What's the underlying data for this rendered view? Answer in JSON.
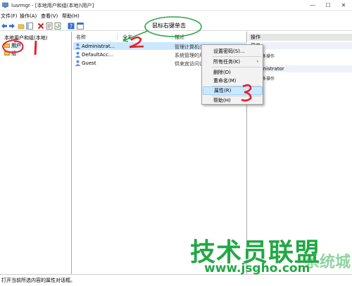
{
  "window": {
    "title": "lusrmgr - [本地用户和组(本地)\\用户]",
    "minimize": "—",
    "maximize": "☐",
    "close": "✕"
  },
  "menu": [
    "文件(F)",
    "操作(A)",
    "查看(V)",
    "帮助(H)"
  ],
  "tree": {
    "root": "本地用户和组(本地)",
    "nodes": [
      {
        "label": "用户",
        "selected": true
      },
      {
        "label": "组",
        "selected": false
      }
    ]
  },
  "list": {
    "columns": [
      "名称",
      "全名",
      "描述"
    ],
    "rows": [
      {
        "name": "Administrat...",
        "description": "管理计算机(域)的内置帐户",
        "selected": true
      },
      {
        "name": "DefaultAcc...",
        "description": "系统管理的用户帐户。",
        "selected": false
      },
      {
        "name": "Guest",
        "description": "供来宾访问计算机或访问域的内...",
        "selected": false
      }
    ]
  },
  "actions": {
    "header": "操作",
    "section1_header": "用户",
    "section1_items": [
      "更多操作"
    ],
    "section2_header": "Administrator",
    "section2_items": [
      "更多操作"
    ]
  },
  "context_menu": {
    "items": [
      "设置密码(S)...",
      "所有任务(K)",
      "删除(D)",
      "重命名(M)",
      "属性(R)",
      "帮助(H)"
    ],
    "submenu_arrow": "›",
    "highlighted_index": 4
  },
  "annotations": {
    "callout": "鼠标右键单击",
    "marks": [
      "1",
      "2",
      "3"
    ]
  },
  "status": "打开当前所选内容的属性对话框。",
  "watermark": {
    "brand": "技术员联盟",
    "url": "www.jsgho.com",
    "side": "系统城"
  },
  "colors": {
    "selection": "#cce8ff",
    "annotation_red": "#e8202a",
    "annotation_green": "#2aa84a",
    "watermark_green": "#22a845"
  }
}
